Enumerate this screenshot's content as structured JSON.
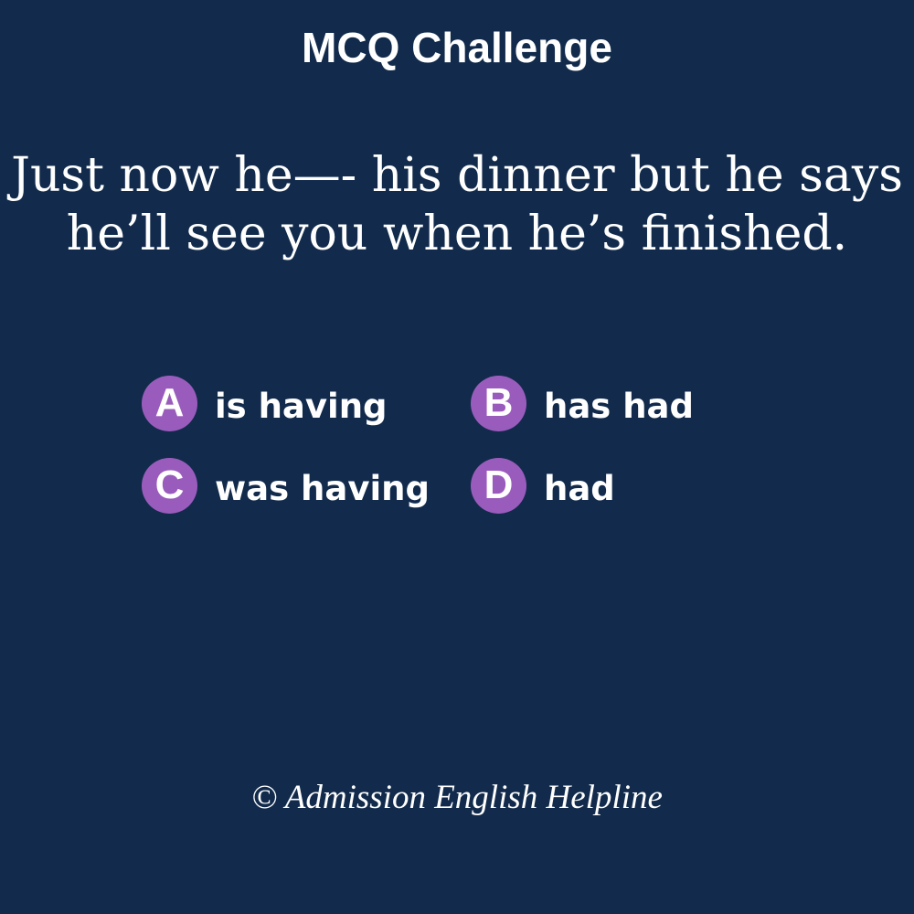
{
  "header": {
    "title": "MCQ Challenge"
  },
  "question": {
    "line1": "Just now he—- his dinner but he says",
    "line2": "he’ll see you when he’s finished."
  },
  "options": [
    {
      "letter": "A",
      "text": "is having"
    },
    {
      "letter": "B",
      "text": "has had"
    },
    {
      "letter": "C",
      "text": "was having"
    },
    {
      "letter": "D",
      "text": "had"
    }
  ],
  "footer": {
    "copyright": "© Admission English Helpline"
  },
  "colors": {
    "background": "#122b4c",
    "badge": "#9a5cbc",
    "text": "#ffffff"
  }
}
